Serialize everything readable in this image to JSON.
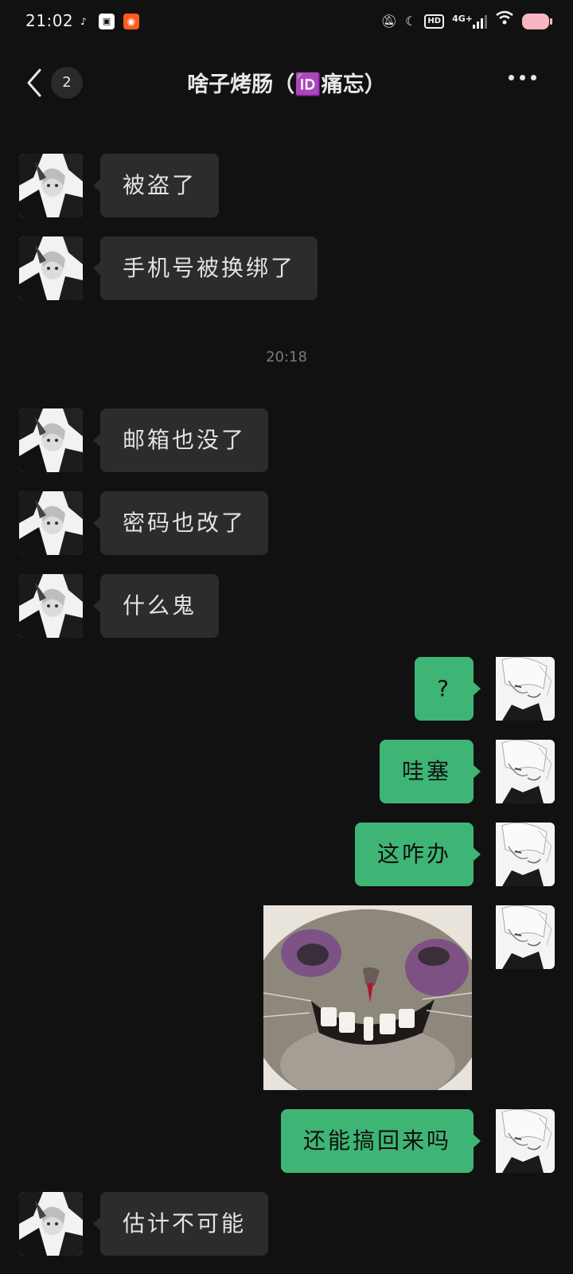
{
  "status_bar": {
    "time": "21:02",
    "network": "4G+",
    "hd": "HD",
    "apps": [
      "tiktok-icon",
      "game-icon",
      "kuaishou-icon"
    ],
    "status_icons": [
      "mute-bell-icon",
      "moon-icon",
      "hd-icon",
      "signal-icon",
      "wifi-icon",
      "battery-icon"
    ]
  },
  "header": {
    "unread_count": "2",
    "title": "啥子烤肠（🆔痛忘）"
  },
  "messages": {
    "m1": "被盗了",
    "m2": "手机号被换绑了",
    "timestamp": "20:18",
    "m3": "邮箱也没了",
    "m4": "密码也改了",
    "m5": "什么鬼",
    "m6": "?",
    "m7": "哇塞",
    "m8": "这咋办",
    "sticker": "hamster-grin-sticker",
    "m9": "还能搞回来吗",
    "m10": "估计不可能"
  },
  "colors": {
    "background": "#111111",
    "incoming_bubble": "#2c2c2c",
    "outgoing_bubble": "#3eb575",
    "timestamp": "#7a7a7a"
  }
}
